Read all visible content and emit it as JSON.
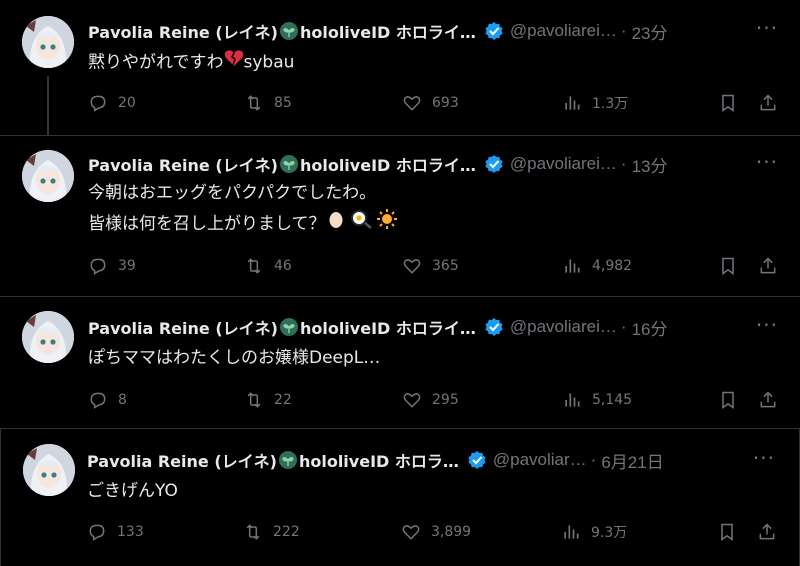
{
  "tweets": [
    {
      "author_name": "Pavolia Reine (レイネ)",
      "author_suffix": "hololiveID ホロライ…",
      "handle": "@pavoliarei…",
      "dot": "·",
      "time": "23分",
      "text_line1": "黙りやがれですわ",
      "text_line1_tail": "sybau",
      "replies": "20",
      "retweets": "85",
      "likes": "693",
      "views": "1.3万"
    },
    {
      "author_name": "Pavolia Reine (レイネ)",
      "author_suffix": "hololiveID ホロライ…",
      "handle": "@pavoliarei…",
      "dot": "·",
      "time": "13分",
      "text_line1": "今朝はおエッグをパクパクでしたわ。",
      "text_line2": "皆様は何を召し上がりまして？",
      "replies": "39",
      "retweets": "46",
      "likes": "365",
      "views": "4,982"
    },
    {
      "author_name": "Pavolia Reine (レイネ)",
      "author_suffix": "hololiveID ホロライ…",
      "handle": "@pavoliarei…",
      "dot": "·",
      "time": "16分",
      "text_line1": "ぽちママはわたくしのお嬢様DeepL…",
      "replies": "8",
      "retweets": "22",
      "likes": "295",
      "views": "5,145"
    },
    {
      "author_name": "Pavolia Reine (レイネ)",
      "author_suffix": "hololiveID ホロラ…",
      "handle": "@pavoliar…",
      "dot": "·",
      "time": "6月21日",
      "text_line1": "ごきげんYO",
      "replies": "133",
      "retweets": "222",
      "likes": "3,899",
      "views": "9.3万"
    }
  ],
  "more_label": "···",
  "colors": {
    "background": "#000000",
    "text": "#e7e9ea",
    "muted": "#71767b",
    "verified": "#1d9bf0",
    "divider": "#2f3336"
  },
  "icons": [
    "reply-icon",
    "retweet-icon",
    "like-icon",
    "views-icon",
    "bookmark-icon",
    "share-icon",
    "verified-badge-icon",
    "sprout-icon",
    "more-icon"
  ]
}
